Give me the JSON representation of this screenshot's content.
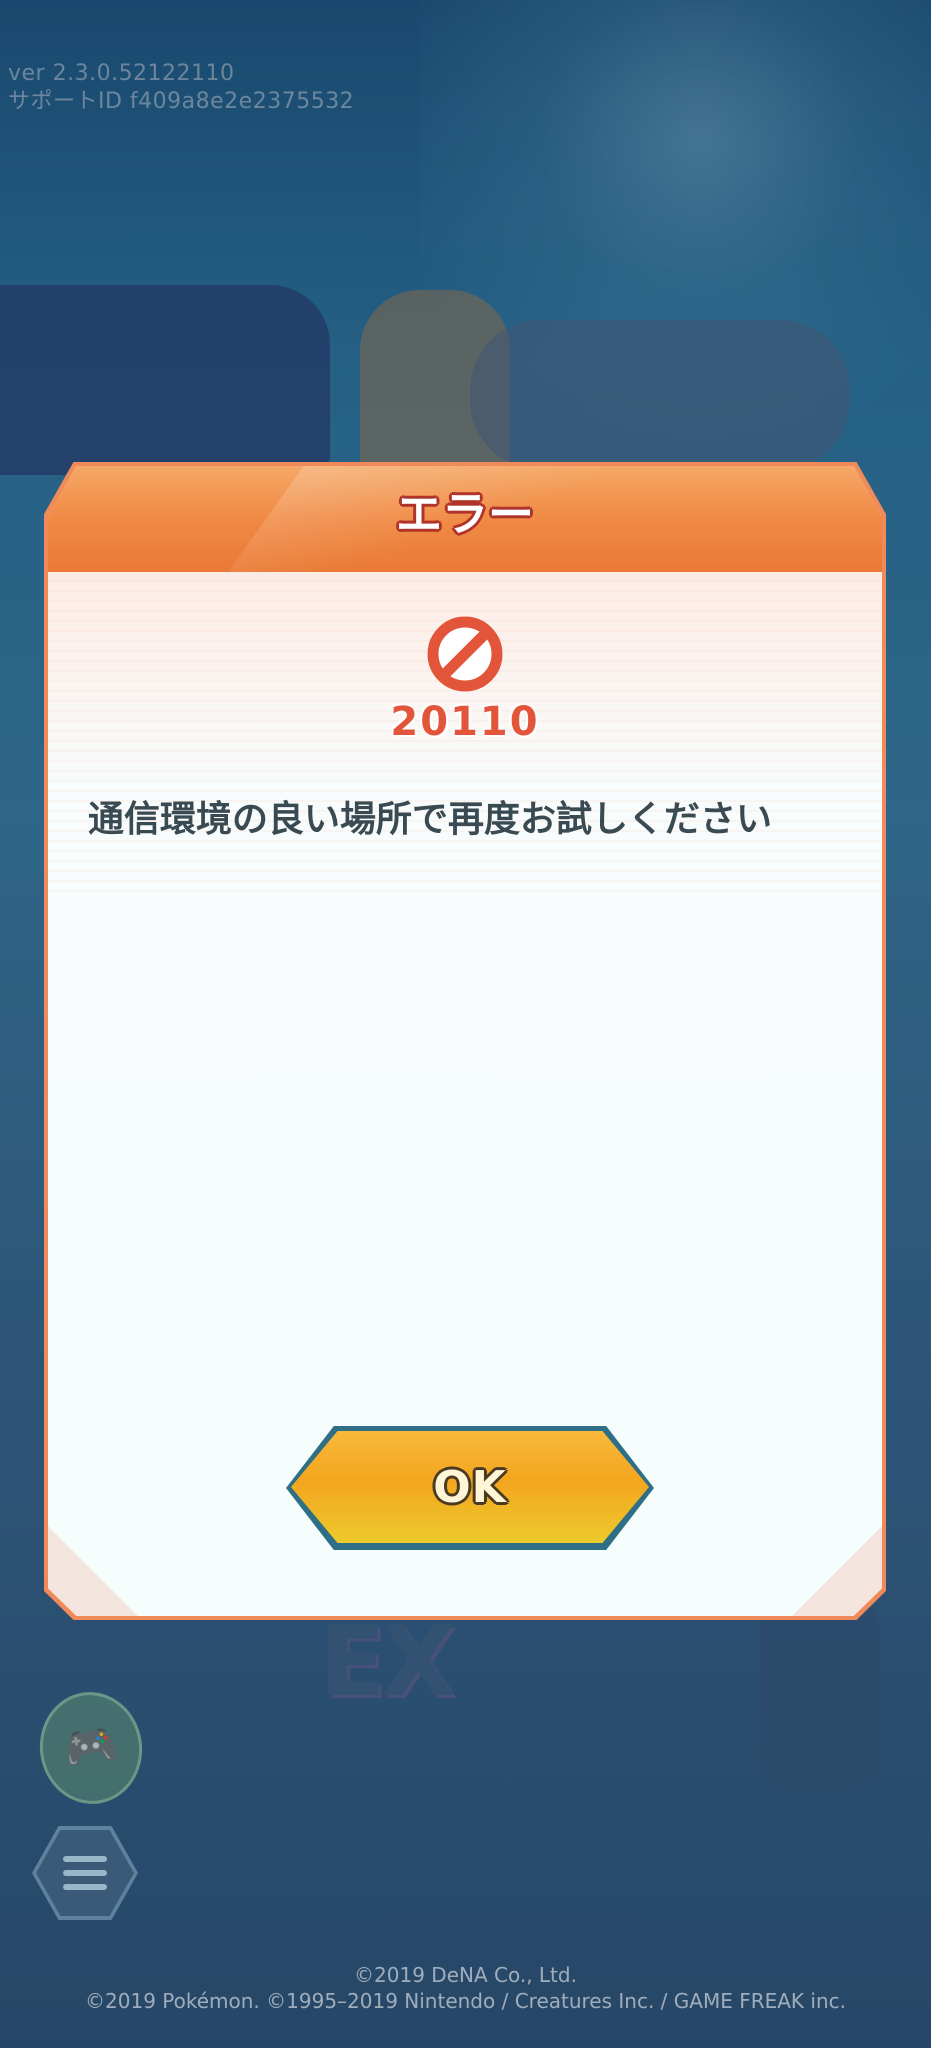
{
  "app": {
    "version_line": "ver 2.3.0.52122110",
    "support_line": "サポートID f409a8e2e2375532"
  },
  "background": {
    "logo_text": "EX"
  },
  "dialog": {
    "title": "エラー",
    "icon": "prohibited-icon",
    "error_code": "20110",
    "message": "通信環境の良い場所で再度お試しください",
    "ok_label": "OK",
    "colors": {
      "header": "#f08a45",
      "title_outline": "#b0342a",
      "error_red": "#e2553a",
      "button_yellow": "#f3a61f"
    }
  },
  "side_buttons": {
    "gamepad": "gamepad-icon",
    "menu": "hamburger-menu-icon"
  },
  "footer": {
    "copyright_line1": "©2019 DeNA Co., Ltd.",
    "copyright_line2": "©2019 Pokémon. ©1995–2019 Nintendo / Creatures Inc. / GAME FREAK inc."
  }
}
